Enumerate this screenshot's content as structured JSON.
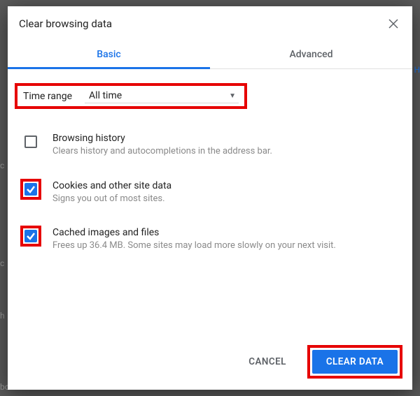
{
  "dialog": {
    "title": "Clear browsing data"
  },
  "tabs": {
    "basic": "Basic",
    "advanced": "Advanced"
  },
  "time_range": {
    "label": "Time range",
    "value": "All time"
  },
  "options": {
    "history": {
      "title": "Browsing history",
      "desc": "Clears history and autocompletions in the address bar.",
      "checked": false
    },
    "cookies": {
      "title": "Cookies and other site data",
      "desc": "Signs you out of most sites.",
      "checked": true
    },
    "cache": {
      "title": "Cached images and files",
      "desc": "Frees up 36.4 MB. Some sites may load more slowly on your next visit.",
      "checked": true
    }
  },
  "footer": {
    "cancel": "Cancel",
    "confirm": "Clear data"
  }
}
